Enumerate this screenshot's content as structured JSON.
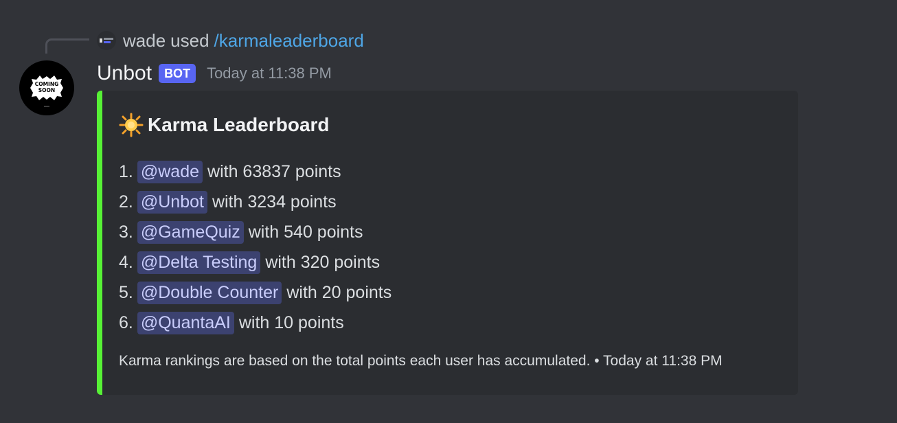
{
  "reply": {
    "username": "wade",
    "action": "used",
    "command": "/karmaleaderboard"
  },
  "message": {
    "author": "Unbot",
    "badge": "BOT",
    "timestamp": "Today at 11:38 PM",
    "avatar_text": [
      "COMING",
      "SOON"
    ]
  },
  "embed": {
    "accent_color": "#57f136",
    "title_icon": "glowing-star-emoji",
    "title": "Karma Leaderboard",
    "leaderboard": [
      {
        "rank": "1.",
        "mention": "@wade",
        "text": "with 63837 points"
      },
      {
        "rank": "2.",
        "mention": "@Unbot",
        "text": "with 3234 points"
      },
      {
        "rank": "3.",
        "mention": "@GameQuiz",
        "text": "with 540 points"
      },
      {
        "rank": "4.",
        "mention": "@Delta Testing",
        "text": "with 320 points"
      },
      {
        "rank": "5.",
        "mention": "@Double Counter",
        "text": "with 20 points"
      },
      {
        "rank": "6.",
        "mention": "@QuantaAI",
        "text": "with 10 points"
      }
    ],
    "footer": "Karma rankings are based on the total points each user has accumulated. • Today at 11:38 PM"
  }
}
